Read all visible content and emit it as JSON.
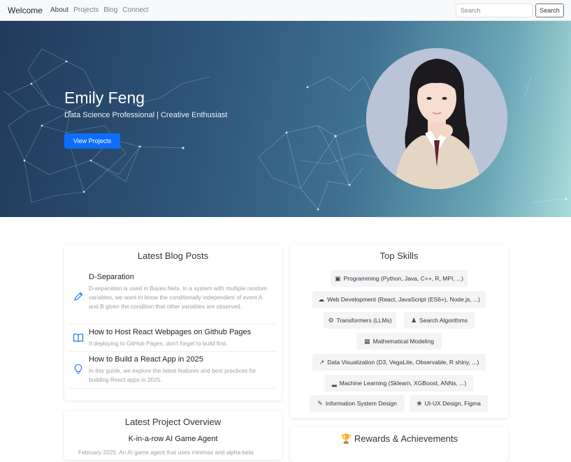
{
  "navbar": {
    "brand": "Welcome",
    "links": [
      "About",
      "Projects",
      "Blog",
      "Connect"
    ],
    "search_placeholder": "Search",
    "search_button": "Search"
  },
  "hero": {
    "name": "Emily Feng",
    "subtitle": "Data Science Professional | Creative Enthusiast",
    "button": "View Projects"
  },
  "blog": {
    "title": "Latest Blog Posts",
    "posts": [
      {
        "icon": "pencil-icon",
        "title": "D-Separation",
        "description": "D-separation is used in Bayes Nets. In a system with multiple random variables, we want to know the conditionally independent of event A and B given the condition that other variables are observed."
      },
      {
        "icon": "book-icon",
        "title": "How to Host React Webpages on Github Pages",
        "description": "If deploying to GitHub Pages, don't forget to build first."
      },
      {
        "icon": "lightbulb-icon",
        "title": "How to Build a React App in 2025",
        "description": "In this guide, we explore the latest features and best practices for building React apps in 2025."
      }
    ]
  },
  "skills": {
    "title": "Top Skills",
    "items": [
      {
        "label": "Programming (Python, Java, C++, R, MPI, ...)",
        "icon": "terminal-icon"
      },
      {
        "label": "Web Development (React, JavaScript (ES6+), Node.js, ...)",
        "icon": "cloud-icon"
      },
      {
        "label": "Transformers (LLMs)",
        "icon": "chip-icon"
      },
      {
        "label": "Search Algorithms",
        "icon": "diagram-icon"
      },
      {
        "label": "Mathematical Modeling",
        "icon": "calculator-icon"
      },
      {
        "label": "Data Visualization (D3, VegaLite, Observable, R shiny, ...)",
        "icon": "line-chart-icon"
      },
      {
        "label": "Machine Learning (Sklearn, XGBoost, ANNs, ...)",
        "icon": "bar-chart-icon"
      },
      {
        "label": "Information System Design",
        "icon": "pencil-icon"
      },
      {
        "label": "UI-UX Design, Figma",
        "icon": "palette-icon"
      }
    ]
  },
  "project": {
    "title": "Latest Project Overview",
    "name": "K-in-a-row AI Game Agent",
    "description": "February 2025: An AI game agent that uses minimax and alpha-beta"
  },
  "rewards": {
    "icon": "trophy-icon",
    "title": "Rewards & Achievements"
  },
  "colors": {
    "primary": "#0d6efd",
    "hero_dark": "#223a5b",
    "hero_light": "#a9dcdc"
  }
}
